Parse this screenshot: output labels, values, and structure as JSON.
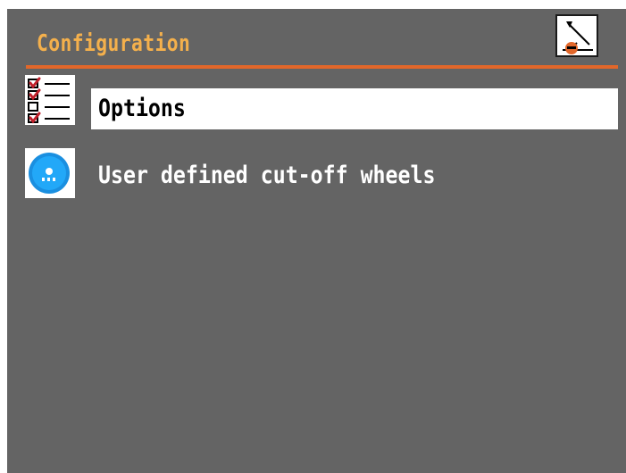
{
  "header": {
    "title": "Configuration",
    "icon": "config-calibration-icon"
  },
  "colors": {
    "background": "#646464",
    "title": "#f4b04c",
    "divider": "#e2672a",
    "selection": "#ffffff"
  },
  "menu": {
    "items": [
      {
        "label": "Options",
        "icon": "checklist-icon",
        "selected": true
      },
      {
        "label": "User defined cut-off wheels",
        "icon": "cut-off-wheel-icon",
        "selected": false
      }
    ]
  }
}
